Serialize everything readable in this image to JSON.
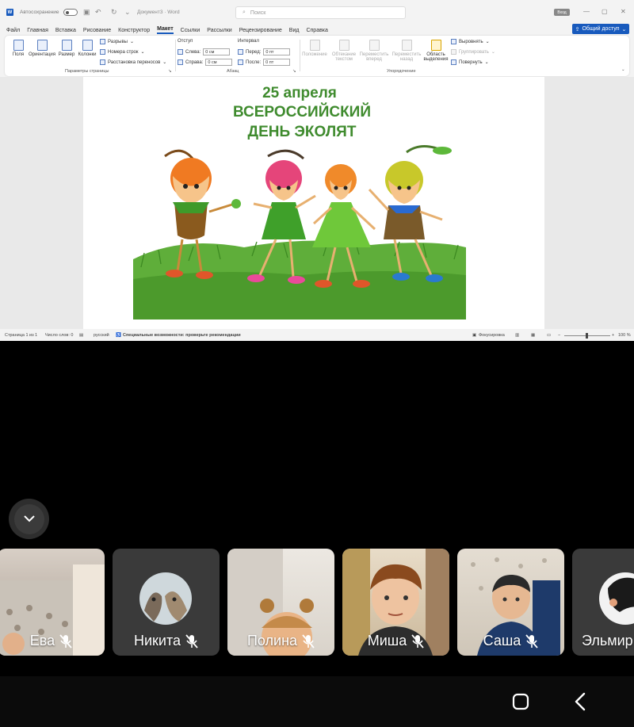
{
  "word": {
    "autosave_label": "Автосохранение",
    "doc_name": "Документ3 · Word",
    "search_placeholder": "Поиск",
    "account_badge": "Вход",
    "share_label": "Общий доступ",
    "menu": [
      "Файл",
      "Главная",
      "Вставка",
      "Рисование",
      "Конструктор",
      "Макет",
      "Ссылки",
      "Рассылки",
      "Рецензирование",
      "Вид",
      "Справка"
    ],
    "active_menu": "Макет",
    "ribbon": {
      "fields_label": "Поля",
      "orientation_label": "Ориентация",
      "size_label": "Размер",
      "columns_label": "Колонки",
      "breaks_label": "Разрывы",
      "line_numbers_label": "Номера строк",
      "hyphenation_label": "Расстановка переносов",
      "group_page_setup": "Параметры страницы",
      "indent_header": "Отступ",
      "indent_left_label": "Слева:",
      "indent_left_value": "0 см",
      "indent_right_label": "Справа:",
      "indent_right_value": "0 см",
      "spacing_header": "Интервал",
      "spacing_before_label": "Перед:",
      "spacing_before_value": "0 пт",
      "spacing_after_label": "После:",
      "spacing_after_value": "0 пт",
      "group_paragraph": "Абзац",
      "position_label": "Положение",
      "wrap_label": "Обтекание текстом",
      "forward_label": "Переместить вперед",
      "backward_label": "Переместить назад",
      "selection_pane_label": "Область выделения",
      "align_label": "Выровнять",
      "group_obj_label": "Группировать",
      "rotate_label": "Повернуть",
      "group_arrange": "Упорядочение"
    },
    "poster": {
      "line1": "25 апреля",
      "line2": "ВСЕРОССИЙСКИЙ",
      "line3": "ДЕНЬ ЭКОЛЯТ"
    },
    "status": {
      "page": "Страница 1 из 1",
      "words": "Число слов: 0",
      "language": "русский",
      "accessibility": "Специальные возможности: проверьте рекомендации",
      "focus": "Фокусировка",
      "zoom": "100 %"
    }
  },
  "participants": [
    {
      "name": "Ева",
      "muted": true
    },
    {
      "name": "Никита",
      "muted": true
    },
    {
      "name": "Полина",
      "muted": true
    },
    {
      "name": "Миша",
      "muted": true
    },
    {
      "name": "Саша",
      "muted": true
    },
    {
      "name": "Эльмир",
      "muted": false
    }
  ],
  "colors": {
    "word_blue": "#185abd",
    "poster_green": "#3f8b2e",
    "tile_dark": "#3a3a3a"
  }
}
